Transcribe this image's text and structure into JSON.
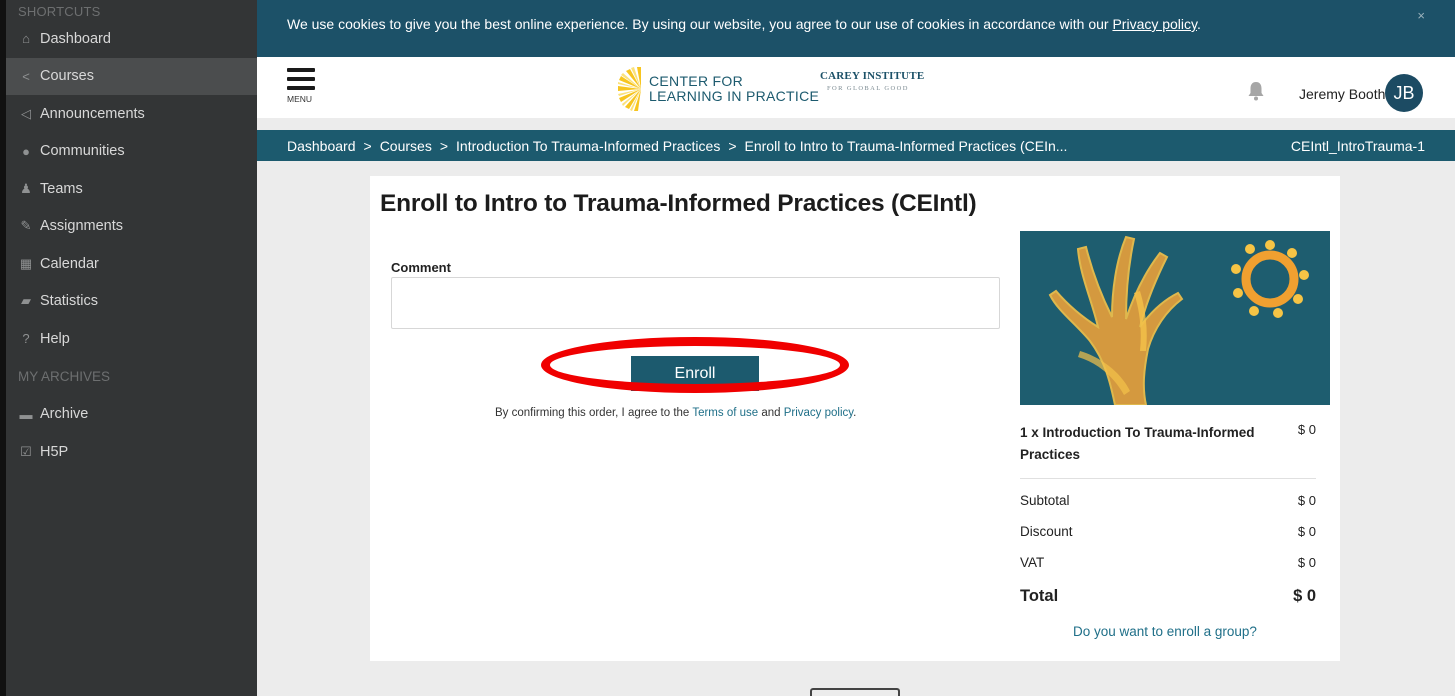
{
  "sidebar": {
    "shortcuts_heading": "SHORTCUTS",
    "items": [
      {
        "label": "Dashboard",
        "icon": "home-icon",
        "glyph": "⌂"
      },
      {
        "label": "Courses",
        "icon": "share-icon",
        "glyph": "<"
      },
      {
        "label": "Announcements",
        "icon": "bullhorn-icon",
        "glyph": "◁"
      },
      {
        "label": "Communities",
        "icon": "comment-icon",
        "glyph": "●"
      },
      {
        "label": "Teams",
        "icon": "group-icon",
        "glyph": "♟"
      },
      {
        "label": "Assignments",
        "icon": "pencil-icon",
        "glyph": "✎"
      },
      {
        "label": "Calendar",
        "icon": "calendar-icon",
        "glyph": "▦"
      },
      {
        "label": "Statistics",
        "icon": "area-chart-icon",
        "glyph": "▰"
      },
      {
        "label": "Help",
        "icon": "question-circle-icon",
        "glyph": "?"
      }
    ],
    "archives_heading": "MY ARCHIVES",
    "archive_items": [
      {
        "label": "Archive",
        "icon": "folder-icon",
        "glyph": "▬"
      },
      {
        "label": "H5P",
        "icon": "check-square-icon",
        "glyph": "☑"
      }
    ]
  },
  "cookie": {
    "text": "We use cookies to give you the best online experience. By using our website, you agree to our use of cookies in accordance with our ",
    "link": "Privacy policy",
    "suffix": ".",
    "close": "×"
  },
  "header": {
    "menu_label": "MENU",
    "logo_line1": "CENTER FOR",
    "logo_line2": "LEARNING IN PRACTICE",
    "partner_line1": "CAREY INSTITUTE",
    "partner_line2": "FOR GLOBAL GOOD",
    "user_name": "Jeremy Booth",
    "avatar_initials": "JB"
  },
  "breadcrumb": {
    "items": [
      "Dashboard",
      "Courses",
      "Introduction To Trauma-Informed Practices",
      "Enroll to Intro to Trauma-Informed Practices (CEIn..."
    ],
    "separator": ">",
    "course_code": "CEIntl_IntroTrauma-1"
  },
  "enroll": {
    "title": "Enroll to Intro to Trauma-Informed Practices (CEIntl)",
    "comment_label": "Comment",
    "comment_value": "",
    "button_label": "Enroll",
    "agree_prefix": "By confirming this order, I agree to the ",
    "terms_link": "Terms of use",
    "agree_and": " and ",
    "privacy_link": "Privacy policy",
    "agree_suffix": "."
  },
  "order": {
    "item_name": "1 x Introduction To Trauma-Informed Practices",
    "item_price": "$ 0",
    "subtotal_label": "Subtotal",
    "subtotal_value": "$ 0",
    "discount_label": "Discount",
    "discount_value": "$ 0",
    "vat_label": "VAT",
    "vat_value": "$ 0",
    "total_label": "Total",
    "total_value": "$ 0",
    "group_link": "Do you want to enroll a group?"
  },
  "colors": {
    "sidebar_bg": "#333536",
    "brand_teal": "#1c5a6e",
    "cookie_bg": "#1c5168",
    "highlight_red": "#f00000"
  }
}
